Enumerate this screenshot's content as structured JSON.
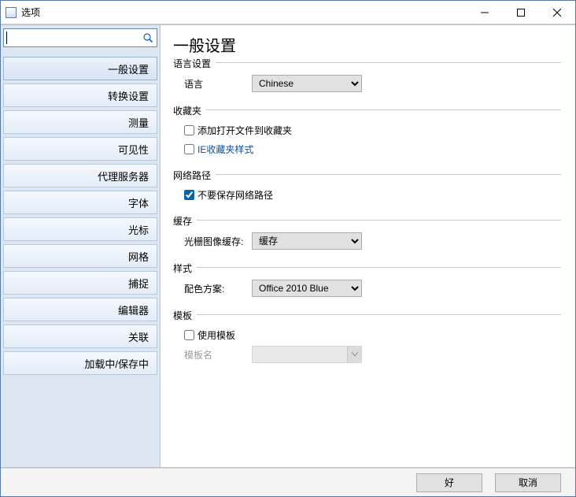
{
  "window": {
    "title": "选项"
  },
  "search": {
    "value": "",
    "placeholder": ""
  },
  "sidebar": {
    "items": [
      {
        "label": "一般设置"
      },
      {
        "label": "转换设置"
      },
      {
        "label": "测量"
      },
      {
        "label": "可见性"
      },
      {
        "label": "代理服务器"
      },
      {
        "label": "字体"
      },
      {
        "label": "光标"
      },
      {
        "label": "网格"
      },
      {
        "label": "捕捉"
      },
      {
        "label": "编辑器"
      },
      {
        "label": "关联"
      },
      {
        "label": "加载中/保存中"
      }
    ],
    "selected_index": 0
  },
  "page": {
    "title": "一般设置",
    "groups": {
      "language": {
        "title": "语言设置",
        "label": "语言",
        "value": "Chinese"
      },
      "favorites": {
        "title": "收藏夹",
        "add": {
          "label": "添加打开文件到收藏夹",
          "checked": false
        },
        "ie": {
          "label": "IE收藏夹样式",
          "checked": false
        }
      },
      "network": {
        "title": "网络路径",
        "nosave": {
          "label": "不要保存网络路径",
          "checked": true
        }
      },
      "cache": {
        "title": "缓存",
        "label": "光栅图像缓存:",
        "value": "缓存"
      },
      "style": {
        "title": "样式",
        "label": "配色方案:",
        "value": "Office 2010 Blue"
      },
      "template": {
        "title": "模板",
        "use": {
          "label": "使用模板",
          "checked": false
        },
        "name_label": "模板名",
        "name_value": ""
      }
    }
  },
  "footer": {
    "ok": "好",
    "cancel": "取消"
  }
}
